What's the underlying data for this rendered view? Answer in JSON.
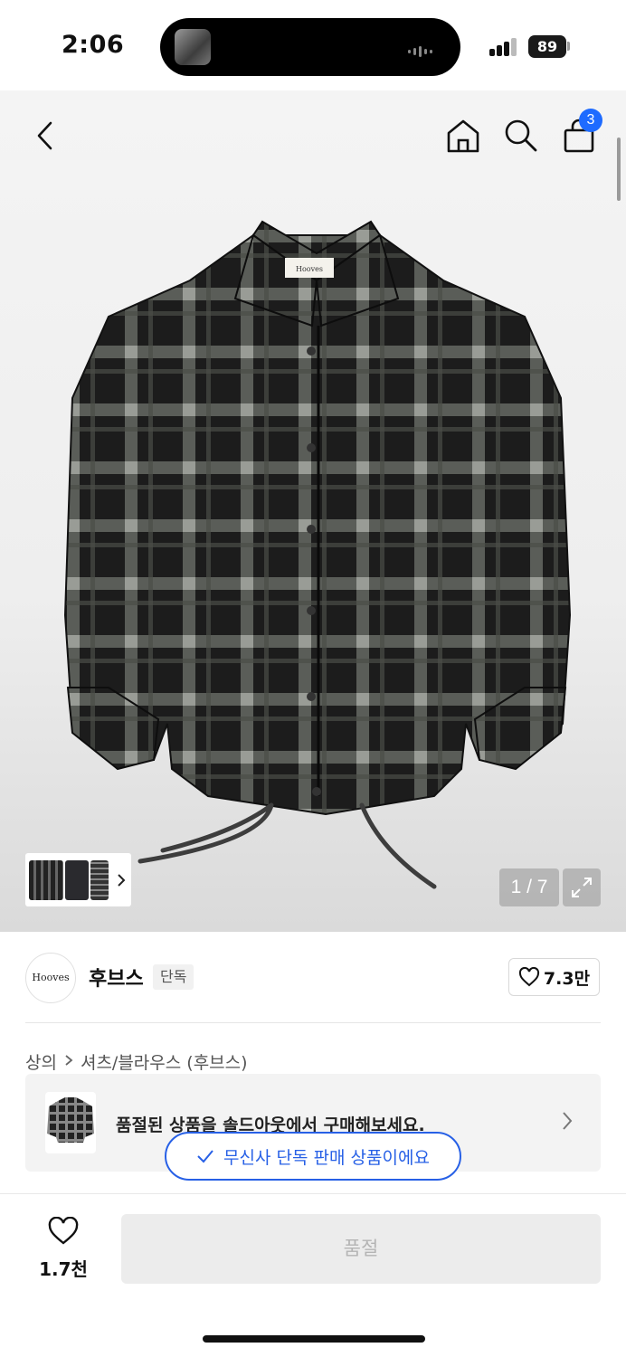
{
  "status_bar": {
    "time": "2:06",
    "battery": "89"
  },
  "header": {
    "cart_count": "3",
    "icons": [
      "back-icon",
      "home-icon",
      "search-icon",
      "shopping-bag-icon"
    ]
  },
  "gallery": {
    "counter": "1 / 7",
    "label_brand": "Hooves"
  },
  "brand": {
    "logo_text": "Hooves",
    "name": "후브스",
    "tag": "단독",
    "likes": "7.3만"
  },
  "breadcrumb": {
    "items": [
      "상의",
      "셔츠/블라우스 (후브스)"
    ]
  },
  "banner": {
    "text": "품절된 상품을 솔드아웃에서 구매해보세요."
  },
  "pill": {
    "text": "무신사 단독 판매 상품이에요"
  },
  "bottom": {
    "wish_count": "1.7천",
    "button_label": "품절"
  },
  "colors": {
    "accent_blue": "#2760e6",
    "badge_blue": "#1e6bff",
    "disabled_bg": "#ececec"
  }
}
